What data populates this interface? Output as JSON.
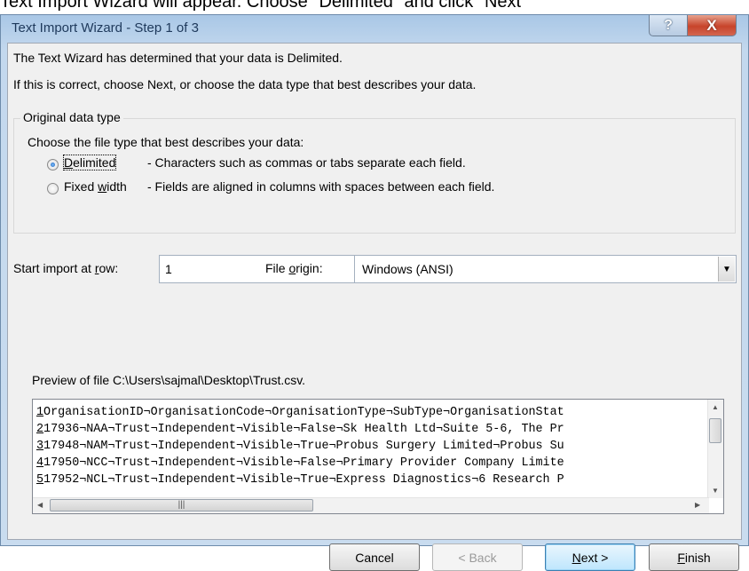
{
  "caption": "Text Import Wizard will appear. Choose \"Delimited\" and click \"Next\"",
  "window": {
    "title": "Text Import Wizard - Step 1 of 3",
    "help_label": "?",
    "close_label": "X"
  },
  "intro": {
    "line1": "The Text Wizard has determined that your data is Delimited.",
    "line2": "If this is correct, choose Next, or choose the data type that best describes your data."
  },
  "original_data_type": {
    "group_label": "Original data type",
    "prompt": "Choose the file type that best describes your data:",
    "options": [
      {
        "label_pre": "",
        "label_key": "D",
        "label_post": "elimited",
        "description": "- Characters such as commas or tabs separate each field.",
        "checked": true
      },
      {
        "label_pre": "Fixed ",
        "label_key": "w",
        "label_post": "idth",
        "description": "- Fields are aligned in columns with spaces between each field.",
        "checked": false
      }
    ]
  },
  "import_row": {
    "label_pre": "Start import at ",
    "label_key": "r",
    "label_post": "ow:",
    "value": "1"
  },
  "file_origin": {
    "label_pre": "File ",
    "label_key": "o",
    "label_post": "rigin:",
    "value": "Windows (ANSI)"
  },
  "preview": {
    "label": "Preview of file C:\\Users\\sajmal\\Desktop\\Trust.csv.",
    "rows": [
      {
        "num": "1",
        "text": "OrganisationID¬OrganisationCode¬OrganisationType¬SubType¬OrganisationStat"
      },
      {
        "num": "2",
        "text": "17936¬NAA¬Trust¬Independent¬Visible¬False¬Sk Health Ltd¬Suite 5-6, The Pr"
      },
      {
        "num": "3",
        "text": "17948¬NAM¬Trust¬Independent¬Visible¬True¬Probus Surgery Limited¬Probus Su"
      },
      {
        "num": "4",
        "text": "17950¬NCC¬Trust¬Independent¬Visible¬False¬Primary Provider Company Limite"
      },
      {
        "num": "5",
        "text": "17952¬NCL¬Trust¬Independent¬Visible¬True¬Express Diagnostics¬6 Research P"
      }
    ]
  },
  "buttons": {
    "cancel": "Cancel",
    "back": "< Back",
    "next_key": "N",
    "next_rest": "ext >",
    "finish_key": "F",
    "finish_rest": "inish"
  }
}
